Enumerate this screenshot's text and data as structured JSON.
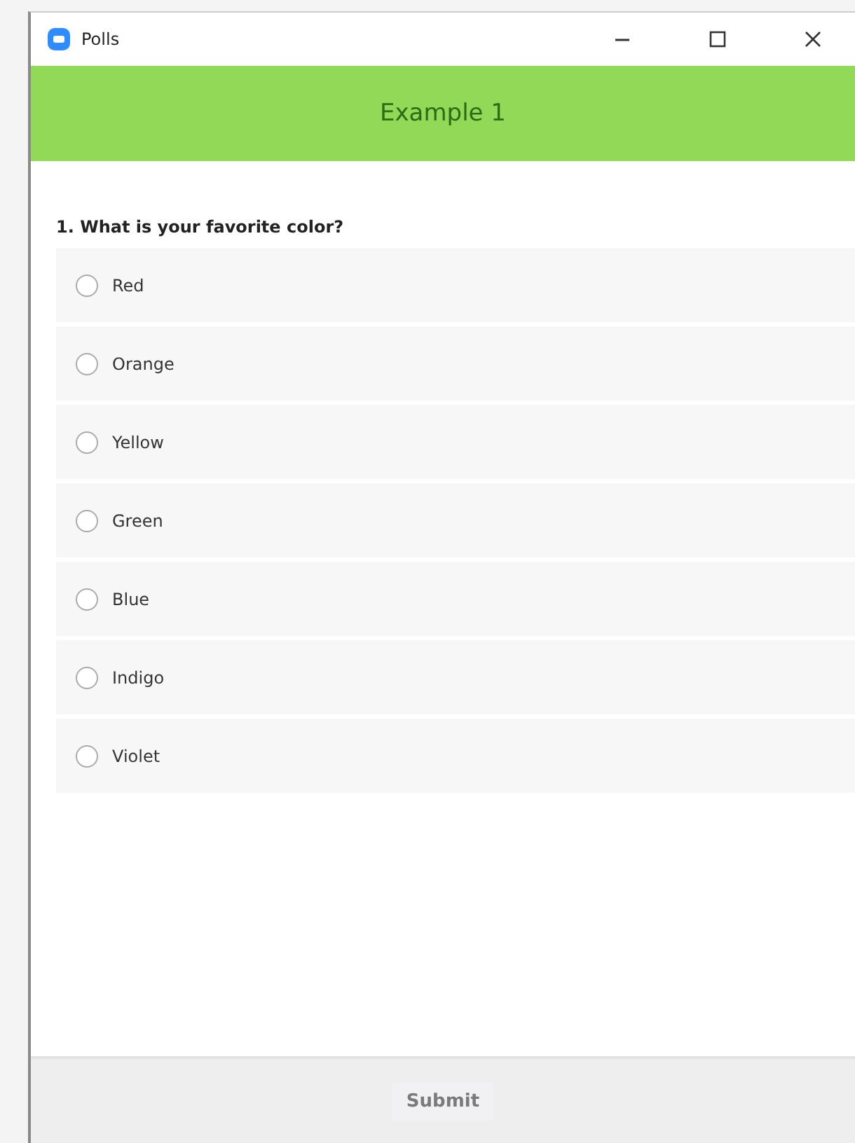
{
  "window": {
    "title": "Polls"
  },
  "header": {
    "title": "Example 1"
  },
  "question": {
    "text": "1. What is your favorite color?",
    "options": [
      {
        "label": "Red",
        "selected": false
      },
      {
        "label": "Orange",
        "selected": false
      },
      {
        "label": "Yellow",
        "selected": false
      },
      {
        "label": "Green",
        "selected": false
      },
      {
        "label": "Blue",
        "selected": false
      },
      {
        "label": "Indigo",
        "selected": false
      },
      {
        "label": "Violet",
        "selected": false
      }
    ]
  },
  "submit": {
    "label": "Submit",
    "disabled": true
  }
}
